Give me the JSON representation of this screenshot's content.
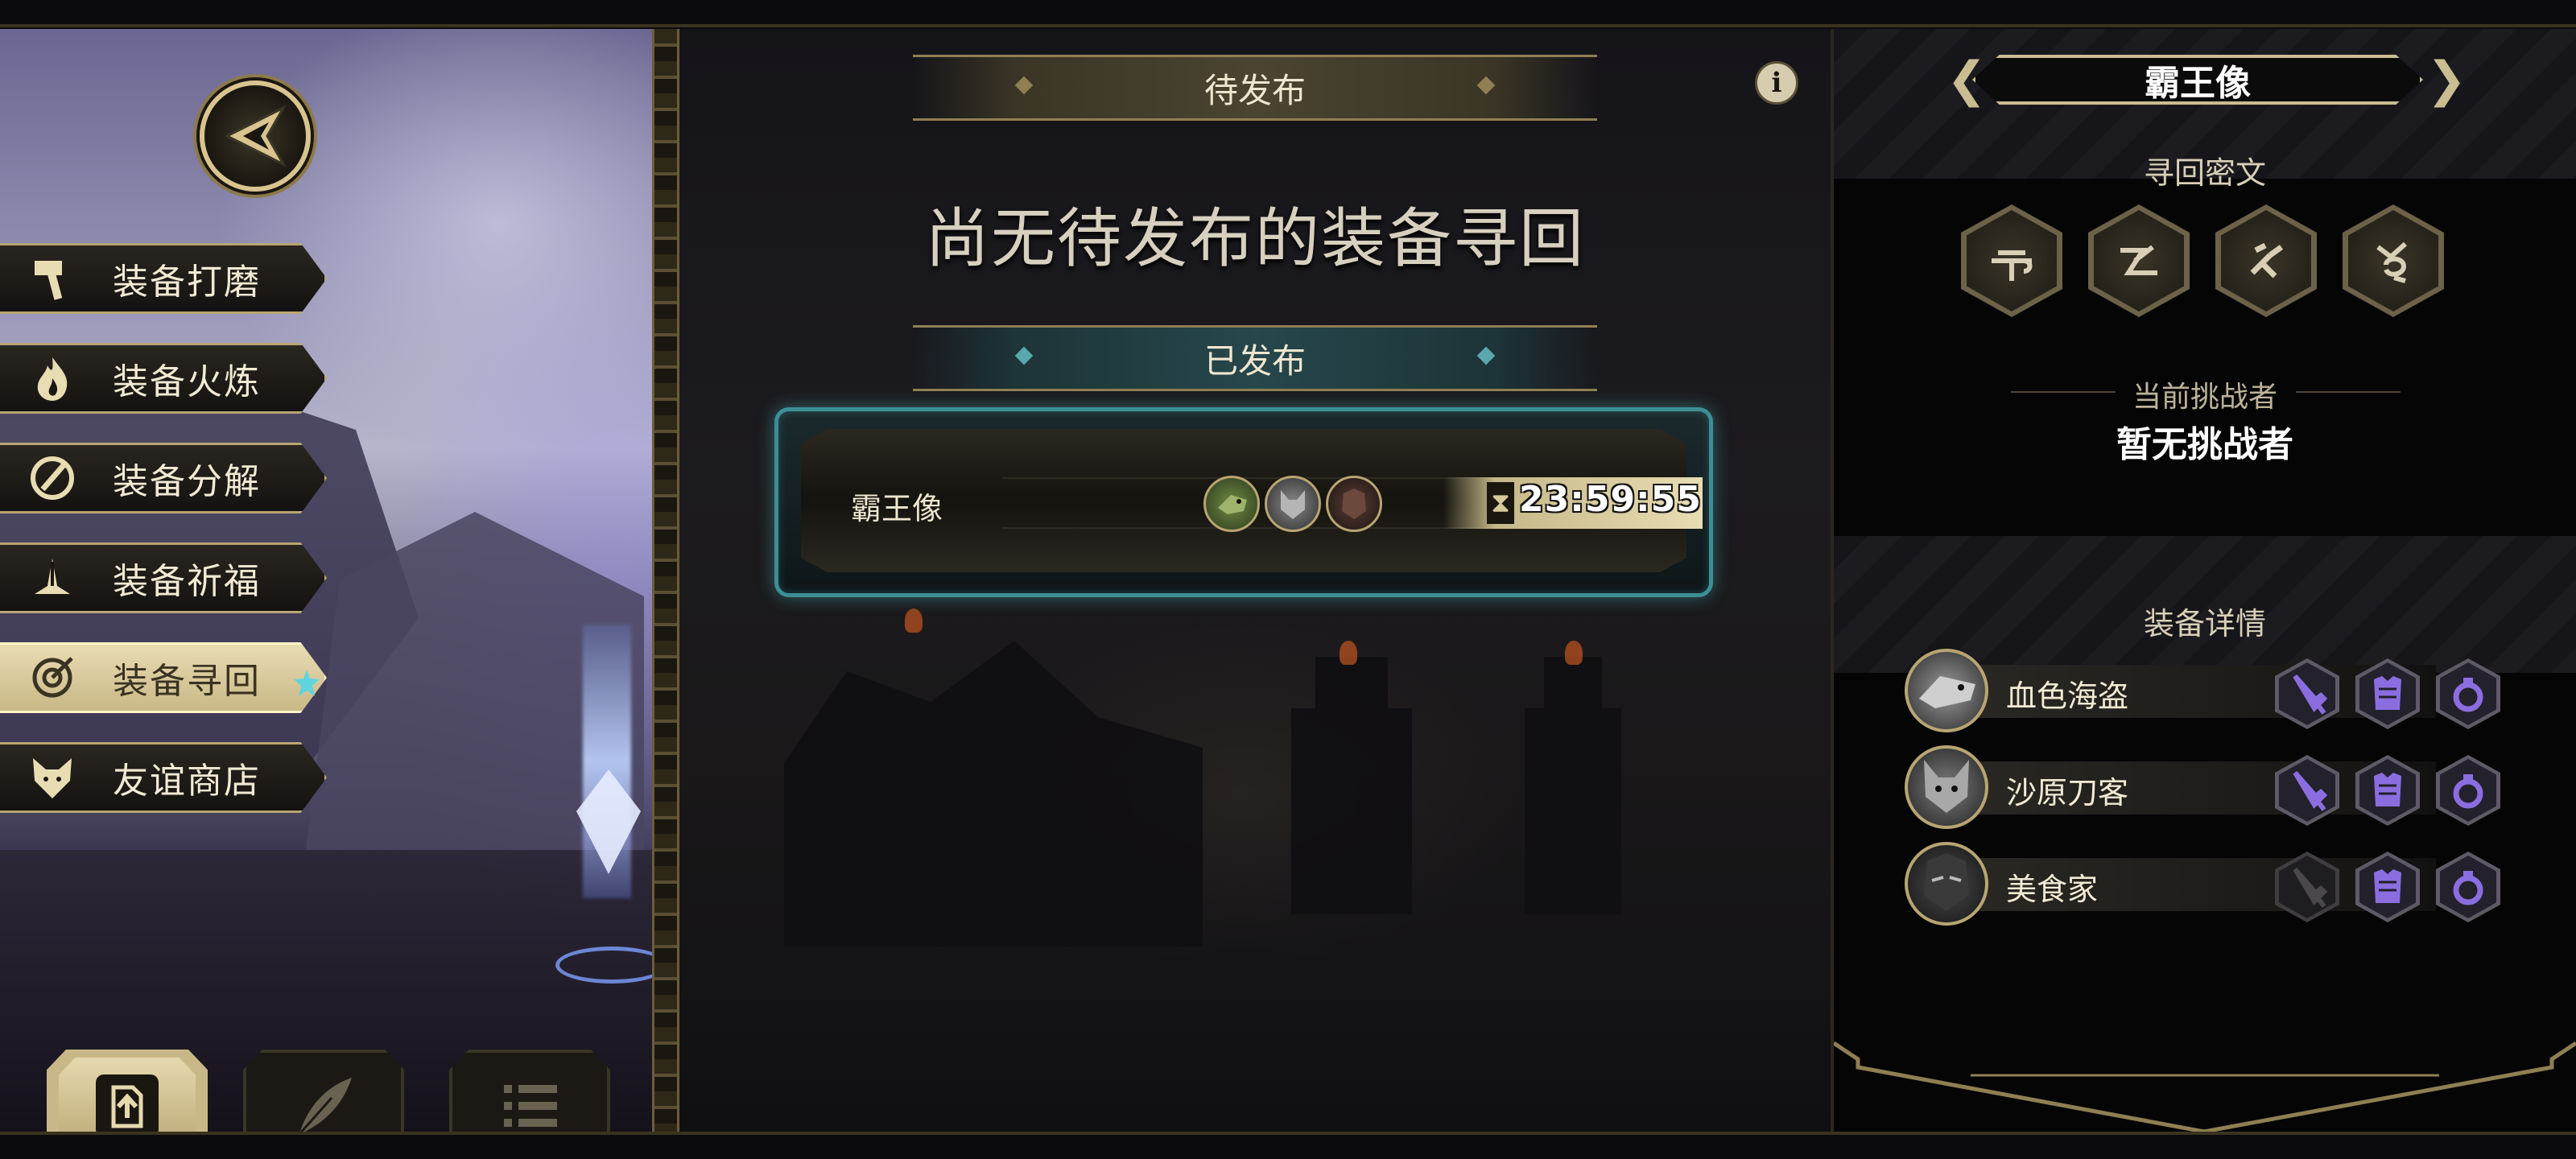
{
  "colors": {
    "gold": "#cbbd92",
    "teal_glow": "#3d8e96",
    "purple_slot": "#8a6ee0",
    "background": "#0b0a0c"
  },
  "sidebar": {
    "back_icon": "back-arrow-icon",
    "items": [
      {
        "label": "装备打磨",
        "icon": "hammer-icon",
        "active": false
      },
      {
        "label": "装备火炼",
        "icon": "flame-icon",
        "active": false
      },
      {
        "label": "装备分解",
        "icon": "disassemble-icon",
        "active": false
      },
      {
        "label": "装备祈福",
        "icon": "pray-icon",
        "active": false
      },
      {
        "label": "装备寻回",
        "icon": "target-icon",
        "active": true
      },
      {
        "label": "友谊商店",
        "icon": "fox-icon",
        "active": false
      }
    ],
    "tools": [
      {
        "icon": "upload-icon"
      },
      {
        "icon": "quill-icon"
      },
      {
        "icon": "list-icon"
      }
    ]
  },
  "center": {
    "pending_header": "待发布",
    "empty_message": "尚无待发布的装备寻回",
    "published_header": "已发布",
    "quest": {
      "name": "霸王像",
      "timer": "23:59:55",
      "timer_icon": "hourglass-icon",
      "portraits": [
        "lizard-hero",
        "wolf-hero",
        "dark-hero"
      ]
    }
  },
  "right_panel": {
    "boss_name": "霸王像",
    "cipher_label": "寻回密文",
    "runes": [
      "rune-1-icon",
      "rune-2-icon",
      "rune-3-icon",
      "rune-4-icon"
    ],
    "challenger_label": "当前挑战者",
    "challenger_value": "暂无挑战者",
    "detail_label": "装备详情",
    "heroes": [
      {
        "name": "血色海盗",
        "weapon_owned": true,
        "armor_owned": true,
        "ring_owned": true
      },
      {
        "name": "沙原刀客",
        "weapon_owned": true,
        "armor_owned": true,
        "ring_owned": true
      },
      {
        "name": "美食家",
        "weapon_owned": false,
        "armor_owned": true,
        "ring_owned": true
      }
    ]
  }
}
